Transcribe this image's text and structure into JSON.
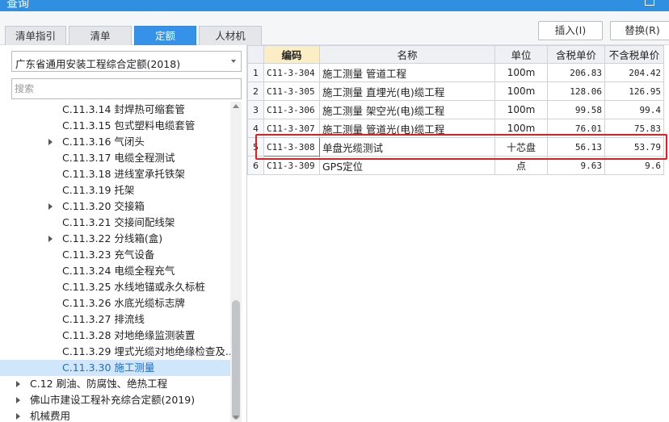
{
  "window": {
    "title": "查询"
  },
  "tabs": [
    {
      "label": "清单指引",
      "active": false
    },
    {
      "label": "清单",
      "active": false
    },
    {
      "label": "定额",
      "active": true
    },
    {
      "label": "人材机",
      "active": false
    }
  ],
  "buttons": {
    "insert": "插入(I)",
    "replace": "替换(R)"
  },
  "dropdown": {
    "value": "广东省通用安装工程综合定额(2018)"
  },
  "search": {
    "placeholder": "搜索",
    "value": ""
  },
  "tree": {
    "items": [
      {
        "label": "C.11.3.14 封焊热可缩套管",
        "expandable": false,
        "level": 3,
        "selected": false
      },
      {
        "label": "C.11.3.15 包式塑料电缆套管",
        "expandable": false,
        "level": 3,
        "selected": false
      },
      {
        "label": "C.11.3.16 气闭头",
        "expandable": true,
        "level": 3,
        "selected": false
      },
      {
        "label": "C.11.3.17 电缆全程测试",
        "expandable": false,
        "level": 3,
        "selected": false
      },
      {
        "label": "C.11.3.18 进线室承托铁架",
        "expandable": false,
        "level": 3,
        "selected": false
      },
      {
        "label": "C.11.3.19 托架",
        "expandable": false,
        "level": 3,
        "selected": false
      },
      {
        "label": "C.11.3.20 交接箱",
        "expandable": true,
        "level": 3,
        "selected": false
      },
      {
        "label": "C.11.3.21 交接间配线架",
        "expandable": false,
        "level": 3,
        "selected": false
      },
      {
        "label": "C.11.3.22 分线箱(盒)",
        "expandable": true,
        "level": 3,
        "selected": false
      },
      {
        "label": "C.11.3.23 充气设备",
        "expandable": false,
        "level": 3,
        "selected": false
      },
      {
        "label": "C.11.3.24 电缆全程充气",
        "expandable": false,
        "level": 3,
        "selected": false
      },
      {
        "label": "C.11.3.25 水线地锚或永久标桩",
        "expandable": false,
        "level": 3,
        "selected": false
      },
      {
        "label": "C.11.3.26 水底光缆标志牌",
        "expandable": false,
        "level": 3,
        "selected": false
      },
      {
        "label": "C.11.3.27 排流线",
        "expandable": false,
        "level": 3,
        "selected": false
      },
      {
        "label": "C.11.3.28 对地绝缘监测装置",
        "expandable": false,
        "level": 3,
        "selected": false
      },
      {
        "label": "C.11.3.29 埋式光缆对地绝缘检查及...",
        "expandable": false,
        "level": 3,
        "selected": false
      },
      {
        "label": "C.11.3.30 施工测量",
        "expandable": false,
        "level": 3,
        "selected": true
      },
      {
        "label": "C.12 刷油、防腐蚀、绝热工程",
        "expandable": true,
        "level": 1,
        "selected": false
      },
      {
        "label": "佛山市建设工程补充综合定额(2019)",
        "expandable": true,
        "level": 1,
        "selected": false
      },
      {
        "label": "机械费用",
        "expandable": true,
        "level": 1,
        "selected": false
      }
    ]
  },
  "table": {
    "columns": [
      "",
      "编码",
      "名称",
      "单位",
      "含税单价",
      "不含税单价"
    ],
    "rows": [
      {
        "idx": "1",
        "code": "C11-3-304",
        "name": "施工测量 管道工程",
        "unit": "100m",
        "price_tax": "206.83",
        "price_notax": "204.42"
      },
      {
        "idx": "2",
        "code": "C11-3-305",
        "name": "施工测量 直埋光(电)缆工程",
        "unit": "100m",
        "price_tax": "128.06",
        "price_notax": "126.95"
      },
      {
        "idx": "3",
        "code": "C11-3-306",
        "name": "施工测量 架空光(电)缆工程",
        "unit": "100m",
        "price_tax": "99.58",
        "price_notax": "99.4"
      },
      {
        "idx": "4",
        "code": "C11-3-307",
        "name": "施工测量 管道光(电)缆工程",
        "unit": "100m",
        "price_tax": "76.01",
        "price_notax": "75.83"
      },
      {
        "idx": "5",
        "code": "C11-3-308",
        "name": "单盘光缆测试",
        "unit": "十芯盘",
        "price_tax": "56.13",
        "price_notax": "53.79"
      },
      {
        "idx": "6",
        "code": "C11-3-309",
        "name": "GPS定位",
        "unit": "点",
        "price_tax": "9.63",
        "price_notax": "9.6"
      }
    ],
    "highlighted_row": 4
  },
  "colors": {
    "accent": "#3691e8",
    "highlight_box": "#e02020",
    "selected_tree_bg": "#cfe6fb",
    "code_header_bg": "#fbeec4"
  }
}
